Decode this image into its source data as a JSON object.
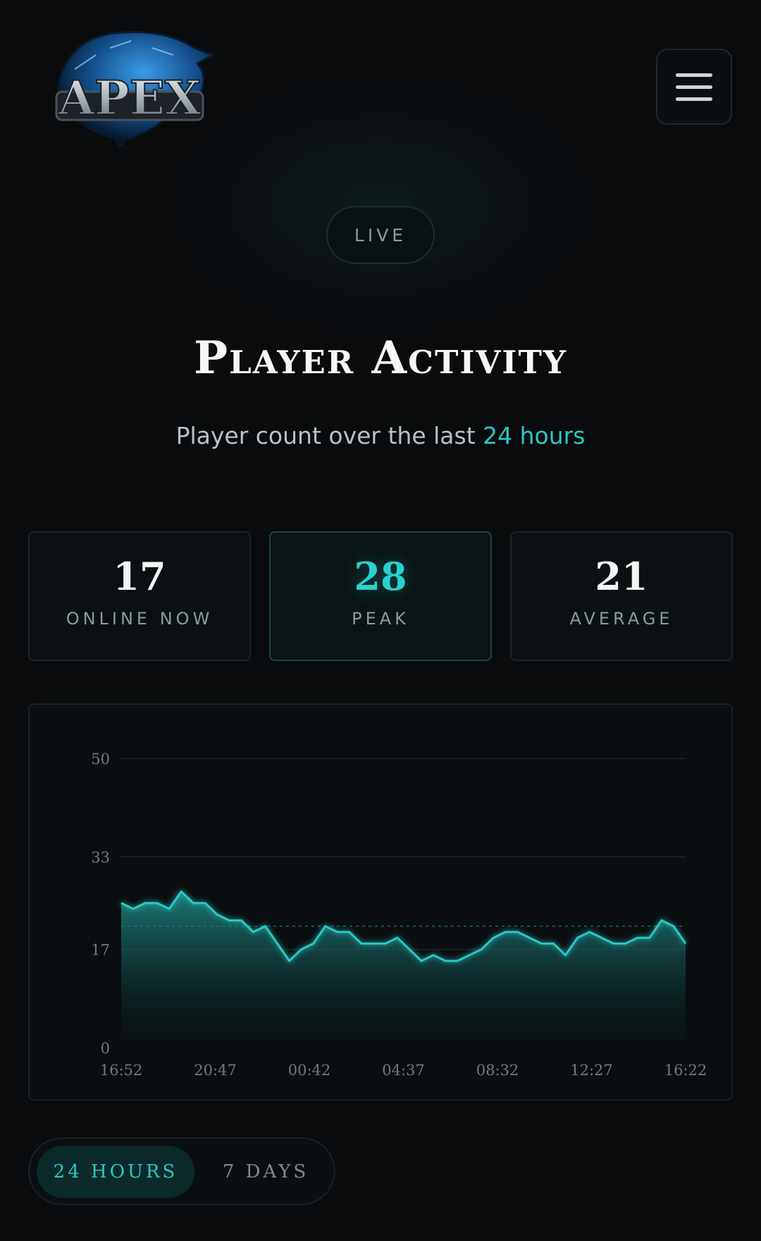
{
  "header": {
    "logo_text": "APEX",
    "menu_icon": "hamburger-icon"
  },
  "badge": {
    "label": "LIVE"
  },
  "hero": {
    "title": "Player Activity",
    "subtitle_prefix": "Player count over the last ",
    "subtitle_accent": "24 hours"
  },
  "stats": [
    {
      "value": "17",
      "label": "ONLINE NOW"
    },
    {
      "value": "28",
      "label": "PEAK"
    },
    {
      "value": "21",
      "label": "AVERAGE"
    }
  ],
  "colors": {
    "accent": "#2ac8c5",
    "background": "#090b0d",
    "card": "#0b1012"
  },
  "chart_data": {
    "type": "area",
    "title": "",
    "xlabel": "",
    "ylabel": "",
    "ylim": [
      0,
      50
    ],
    "yticks": [
      "0",
      "17",
      "33",
      "50"
    ],
    "xticks": [
      "16:52",
      "20:47",
      "00:42",
      "04:37",
      "08:32",
      "12:27",
      "16:22"
    ],
    "average": 21,
    "grid": true,
    "values": [
      25,
      24,
      25,
      25,
      24,
      27,
      25,
      25,
      23,
      22,
      22,
      20,
      21,
      18,
      15,
      17,
      18,
      21,
      20,
      20,
      18,
      18,
      18,
      19,
      17,
      15,
      16,
      15,
      15,
      16,
      17,
      19,
      20,
      20,
      19,
      18,
      18,
      16,
      19,
      20,
      19,
      18,
      18,
      19,
      19,
      22,
      21,
      18
    ]
  },
  "range_toggle": {
    "options": [
      "24 HOURS",
      "7 DAYS"
    ],
    "selected": "24 HOURS"
  }
}
